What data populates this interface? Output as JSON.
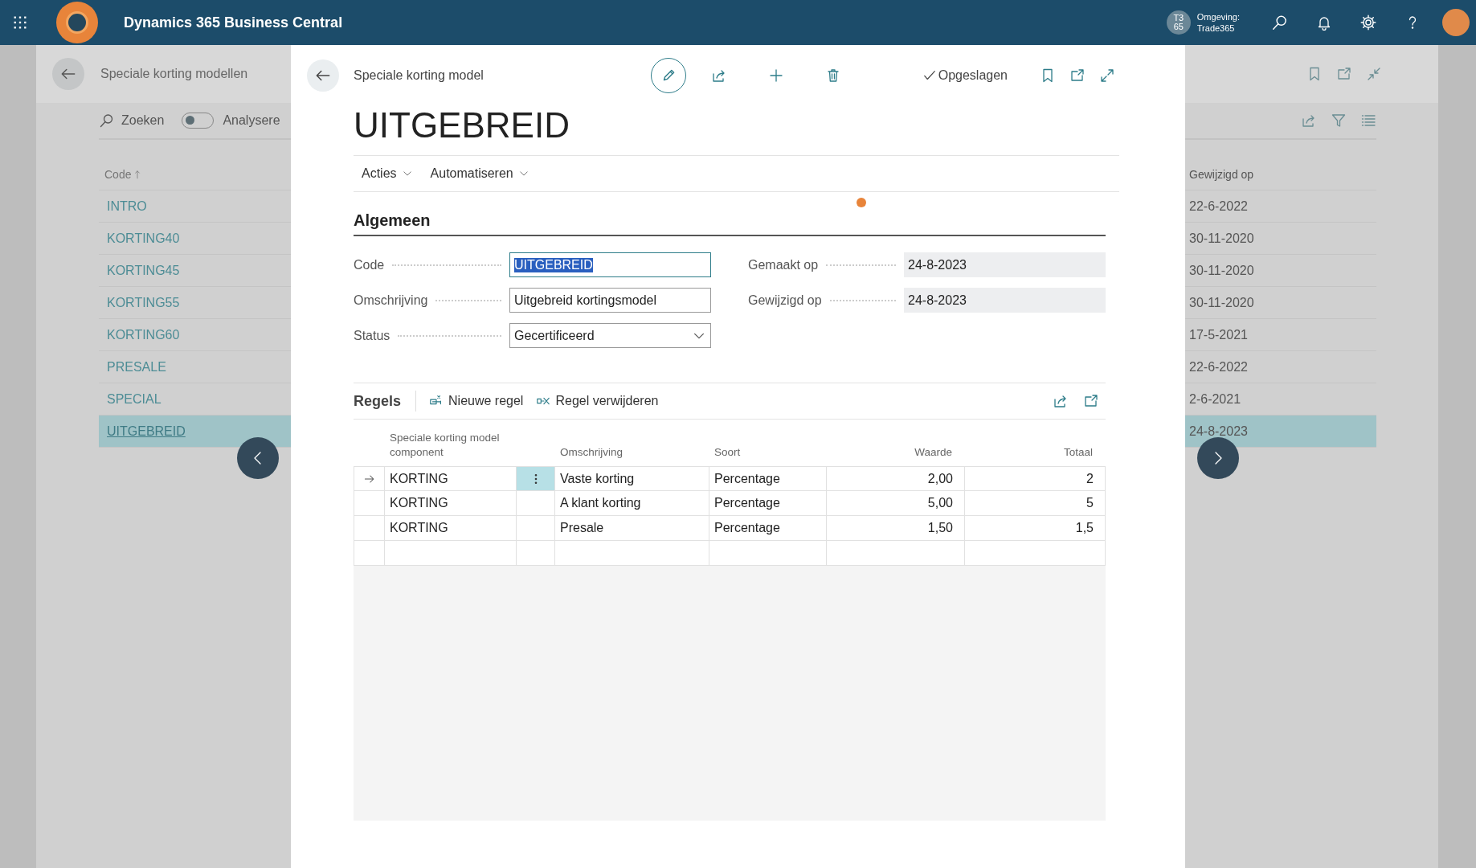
{
  "app_bar": {
    "title": "Dynamics 365 Business Central",
    "environment_badge": [
      "T3",
      "65"
    ],
    "environment_label": "Omgeving:",
    "environment_name": "Trade365"
  },
  "list_page": {
    "title": "Speciale korting modellen",
    "search_label": "Zoeken",
    "analyze_toggle": {
      "label": "Analysere",
      "on": false
    },
    "columns": {
      "code": "Code",
      "modified": "Gewijzigd op"
    },
    "rows": [
      {
        "code": "INTRO",
        "modified": "22-6-2022",
        "selected": false
      },
      {
        "code": "KORTING40",
        "modified": "30-11-2020",
        "selected": false
      },
      {
        "code": "KORTING45",
        "modified": "30-11-2020",
        "selected": false
      },
      {
        "code": "KORTING55",
        "modified": "30-11-2020",
        "selected": false
      },
      {
        "code": "KORTING60",
        "modified": "17-5-2021",
        "selected": false
      },
      {
        "code": "PRESALE",
        "modified": "22-6-2022",
        "selected": false
      },
      {
        "code": "SPECIAL",
        "modified": "2-6-2021",
        "selected": false
      },
      {
        "code": "UITGEBREID",
        "modified": "24-8-2023",
        "selected": true
      }
    ]
  },
  "card": {
    "breadcrumb": "Speciale korting model",
    "save_status": "Opgeslagen",
    "title": "UITGEBREID",
    "menu": [
      {
        "label": "Acties"
      },
      {
        "label": "Automatiseren"
      }
    ],
    "section": "Algemeen",
    "fields_left": [
      {
        "label": "Code",
        "value": "UITGEBREID",
        "kind": "text",
        "highlighted": true
      },
      {
        "label": "Omschrijving",
        "value": "Uitgebreid kortingsmodel",
        "kind": "text"
      },
      {
        "label": "Status",
        "value": "Gecertificeerd",
        "kind": "dropdown"
      }
    ],
    "fields_right": [
      {
        "label": "Gemaakt op",
        "value": "24-8-2023",
        "kind": "readonly"
      },
      {
        "label": "Gewijzigd op",
        "value": "24-8-2023",
        "kind": "readonly"
      }
    ],
    "lines": {
      "title": "Regels",
      "actions": [
        {
          "label": "Nieuwe regel",
          "kind": "new"
        },
        {
          "label": "Regel verwijderen",
          "kind": "delete"
        }
      ],
      "columns": [
        "Speciale korting model component",
        "Omschrijving",
        "Soort",
        "Waarde",
        "Totaal"
      ],
      "rows": [
        {
          "component": "KORTING",
          "description": "Vaste korting",
          "type": "Percentage",
          "value": "2,00",
          "total": "2",
          "current": true
        },
        {
          "component": "KORTING",
          "description": "A klant korting",
          "type": "Percentage",
          "value": "5,00",
          "total": "5",
          "current": false
        },
        {
          "component": "KORTING",
          "description": "Presale",
          "type": "Percentage",
          "value": "1,50",
          "total": "1,5",
          "current": false
        }
      ]
    }
  }
}
